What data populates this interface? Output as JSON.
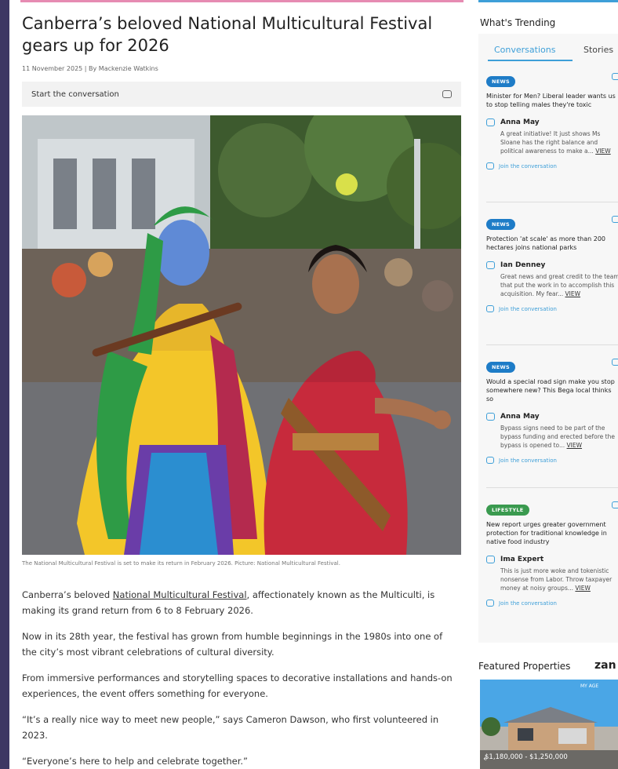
{
  "article": {
    "headline": "Canberra’s beloved National Multicultural Festival gears up for 2026",
    "byline": "11 November 2025 | By Mackenzie Watkins",
    "conversation_bar": "Start the conversation",
    "photo_caption": "The National Multicultural Festival is set to make its return in February 2026. Picture: National Multicultural Festival.",
    "para1_pre": "Canberra’s beloved ",
    "para1_link": "National Multicultural Festival",
    "para1_post": ", affectionately known as the Multiculti, is making its grand return from 6 to 8 February 2026.",
    "para2": "Now in its 28th year, the festival has grown from humble beginnings in the 1980s into one of the city’s most vibrant celebrations of cultural diversity.",
    "para3": "From immersive performances and storytelling spaces to decorative installations and hands-on experiences, the event offers something for everyone.",
    "para4": "“It’s a really nice way to meet new people,” says Cameron Dawson, who first volunteered in 2023.",
    "para5": "“Everyone’s here to help and celebrate together.”"
  },
  "sidebar": {
    "title": "What's Trending",
    "tabs": [
      {
        "label": "Conversations",
        "active": true
      },
      {
        "label": "Stories",
        "active": false
      }
    ],
    "items": [
      {
        "badge": "NEWS",
        "headline": "Minister for Men? Liberal leader wants us to stop telling males they're toxic",
        "commenter": "Anna May",
        "comment": "A great initiative! It just shows Ms Sloane has the right balance and political awareness to make a...",
        "view": "VIEW",
        "join": "Join the conversation"
      },
      {
        "badge": "NEWS",
        "headline": "Protection 'at scale' as more than 200 hectares joins national parks",
        "commenter": "Ian Denney",
        "comment": "Great news and great credit to the team that put the work in to accomplish this acquisition. My fear...",
        "view": "VIEW",
        "join": "Join the conversation"
      },
      {
        "badge": "NEWS",
        "headline": "Would a special road sign make you stop somewhere new? This Bega local thinks so",
        "commenter": "Anna May",
        "comment": "Bypass signs need to be part of the bypass funding and erected before the bypass is opened to...",
        "view": "VIEW",
        "join": "Join the conversation"
      },
      {
        "badge": "LIFESTYLE",
        "headline": "New report urges greater government protection for traditional knowledge in native food industry",
        "commenter": "Ima Expert",
        "comment": "This is just more woke and tokenistic nonsense from Labor. Throw taxpayer money at noisy groups...",
        "view": "VIEW",
        "join": "Join the conversation"
      }
    ],
    "featured_title": "Featured Properties",
    "featured_brand": "zan",
    "property_price": "$1,180,000 - $1,250,000",
    "property_agency": "MY AGE"
  },
  "colors": {
    "accent_pink": "#e68bb2",
    "accent_blue": "#3e9fd8",
    "news_badge": "#1e7cc7",
    "lifestyle_badge": "#3a9a4f"
  }
}
